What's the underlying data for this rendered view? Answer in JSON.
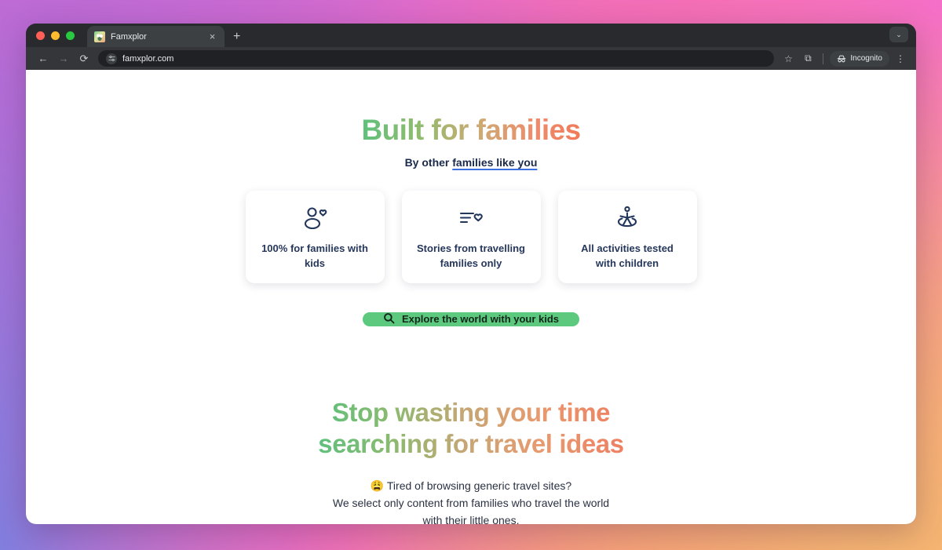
{
  "browser": {
    "tab": {
      "title": "Famxplor",
      "favicon_icon": "famxplor-favicon",
      "close_icon": "×"
    },
    "new_tab_label": "+",
    "window_menu_icon": "⌄",
    "nav": {
      "back_icon": "←",
      "forward_icon": "→",
      "reload_icon": "⟳"
    },
    "omnibox": {
      "tune_icon": "site-settings-icon",
      "url": "famxplor.com"
    },
    "actions": {
      "bookmark_icon": "☆",
      "split_icon": "⧉",
      "incognito_label": "Incognito",
      "incognito_icon": "incognito-hat-icon",
      "menu_icon": "⋮"
    }
  },
  "hero": {
    "title": "Built for families",
    "subtitle_prefix": "By other ",
    "subtitle_link": "families like you",
    "cards": [
      {
        "icon": "person-heart-icon",
        "label": "100% for families with kids"
      },
      {
        "icon": "list-heart-icon",
        "label": "Stories from travelling families only"
      },
      {
        "icon": "child-play-icon",
        "label": "All activities tested with children"
      }
    ],
    "cta": {
      "icon": "search-icon",
      "label": "Explore the world with your kids"
    }
  },
  "section": {
    "title_line1": "Stop wasting your time",
    "title_line2": "searching for travel ideas",
    "lede_line1": "😩 Tired of browsing generic travel sites?",
    "lede_line2": "We select only content from families who travel the world with their little ones."
  },
  "colors": {
    "accent_green": "#5dc97f",
    "link_blue": "#3b6fe0",
    "card_text": "#26375c",
    "gradient_start": "#5ec07c",
    "gradient_end": "#ef7f62"
  }
}
